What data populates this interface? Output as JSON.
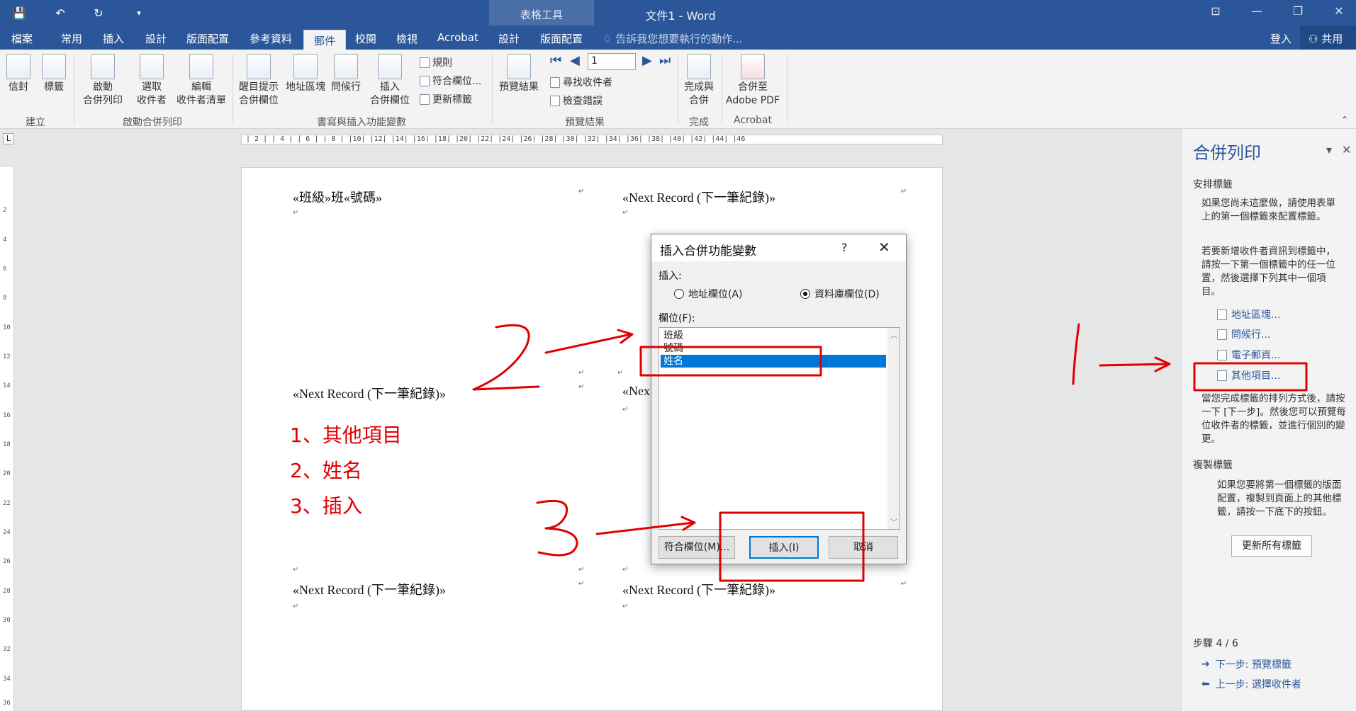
{
  "app": {
    "doc_title": "文件1 - Word",
    "context_tab_title": "表格工具"
  },
  "quick_access": {
    "save_glyph": "💾",
    "undo_glyph": "↶",
    "redo_glyph": "↻",
    "customize_glyph": "▾"
  },
  "window_controls": {
    "restore_ribbon": "⊡",
    "minimize": "—",
    "maximize": "❐",
    "close": "✕"
  },
  "tabs": [
    "檔案",
    "常用",
    "插入",
    "設計",
    "版面配置",
    "參考資料",
    "郵件",
    "校閱",
    "檢視",
    "Acrobat",
    "設計",
    "版面配置"
  ],
  "tell_me": "告訴我您想要執行的動作...",
  "signin": "登入",
  "share": "共用",
  "ribbon": {
    "envelopes": "信封",
    "labels": "標籤",
    "create_group": "建立",
    "start_merge": [
      "啟動",
      "合併列印"
    ],
    "select_recipients": [
      "選取",
      "收件者"
    ],
    "edit_list": [
      "編輯",
      "收件者清單"
    ],
    "start_group": "啟動合併列印",
    "highlight_fields": [
      "醒目提示",
      "合併欄位"
    ],
    "address_block": "地址區塊",
    "greeting_line": "問候行",
    "insert_field": [
      "插入",
      "合併欄位"
    ],
    "rules": "規則",
    "match_fields": "符合欄位...",
    "update_labels": "更新標籤",
    "write_group": "書寫與插入功能變數",
    "preview_results": "預覽結果",
    "record_value": "1",
    "find_recipient": "尋找收件者",
    "check_errors": "檢查錯誤",
    "preview_group": "預覽結果",
    "finish_merge": [
      "完成與",
      "合併"
    ],
    "finish_group": "完成",
    "merge_pdf": [
      "合併至",
      "Adobe PDF"
    ],
    "acrobat_group": "Acrobat"
  },
  "ruler": {
    "h_ticks": "| 2 |  | 4 |  | 6 |  | 8 |  |10|  |12|  |14|  |16|  |18|  |20|  |22|  |24|  |26|  |28|  |30|  |32|  |34|  |36|  |38|  |40|  |42|  |44|  |46",
    "v_ticks": [
      "2",
      "4",
      "6",
      "8",
      "10",
      "12",
      "14",
      "16",
      "18",
      "20",
      "22",
      "24",
      "26",
      "28",
      "30",
      "32",
      "34",
      "36"
    ]
  },
  "page": {
    "cell_1": "«班級»班«號碼»",
    "next_record": "«Next Record (下一筆紀錄)»",
    "next_partial": "«Nex",
    "notes": [
      "1、其他項目",
      "2、姓名",
      "3、插入"
    ]
  },
  "dialog": {
    "title": "插入合併功能變數",
    "help": "?",
    "close": "✕",
    "insert_label": "插入:",
    "radio_address": "地址欄位(A)",
    "radio_database": "資料庫欄位(D)",
    "fields_label": "欄位(F):",
    "fields": [
      "班級",
      "號碼",
      "姓名"
    ],
    "selected_field": "姓名",
    "btn_match": "符合欄位(M)...",
    "btn_insert": "插入(I)",
    "btn_cancel": "取消"
  },
  "taskpane": {
    "title": "合併列印",
    "dropdown": "▾",
    "close": "✕",
    "arrange_head": "安排標籤",
    "para1": "如果您尚未這麼做，請使用表單上的第一個標籤來配置標籤。",
    "para2": "若要新增收件者資訊到標籤中，請按一下第一個標籤中的任一位置，然後選擇下列其中一個項目。",
    "links": [
      "地址區塊...",
      "問候行...",
      "電子郵資...",
      "其他項目..."
    ],
    "para3": "當您完成標籤的排列方式後，請按一下 [下一步]。然後您可以預覽每位收件者的標籤，並進行個別的變更。",
    "copy_head": "複製標籤",
    "para4": "如果您要將第一個標籤的版面配置，複製到頁面上的其他標籤，請按一下底下的按鈕。",
    "update_btn": "更新所有標籤",
    "step": "步驟 4 / 6",
    "next_step": "下一步: 預覽標籤",
    "prev_step": "上一步: 選擇收件者"
  },
  "annotation_color": "#e00000"
}
